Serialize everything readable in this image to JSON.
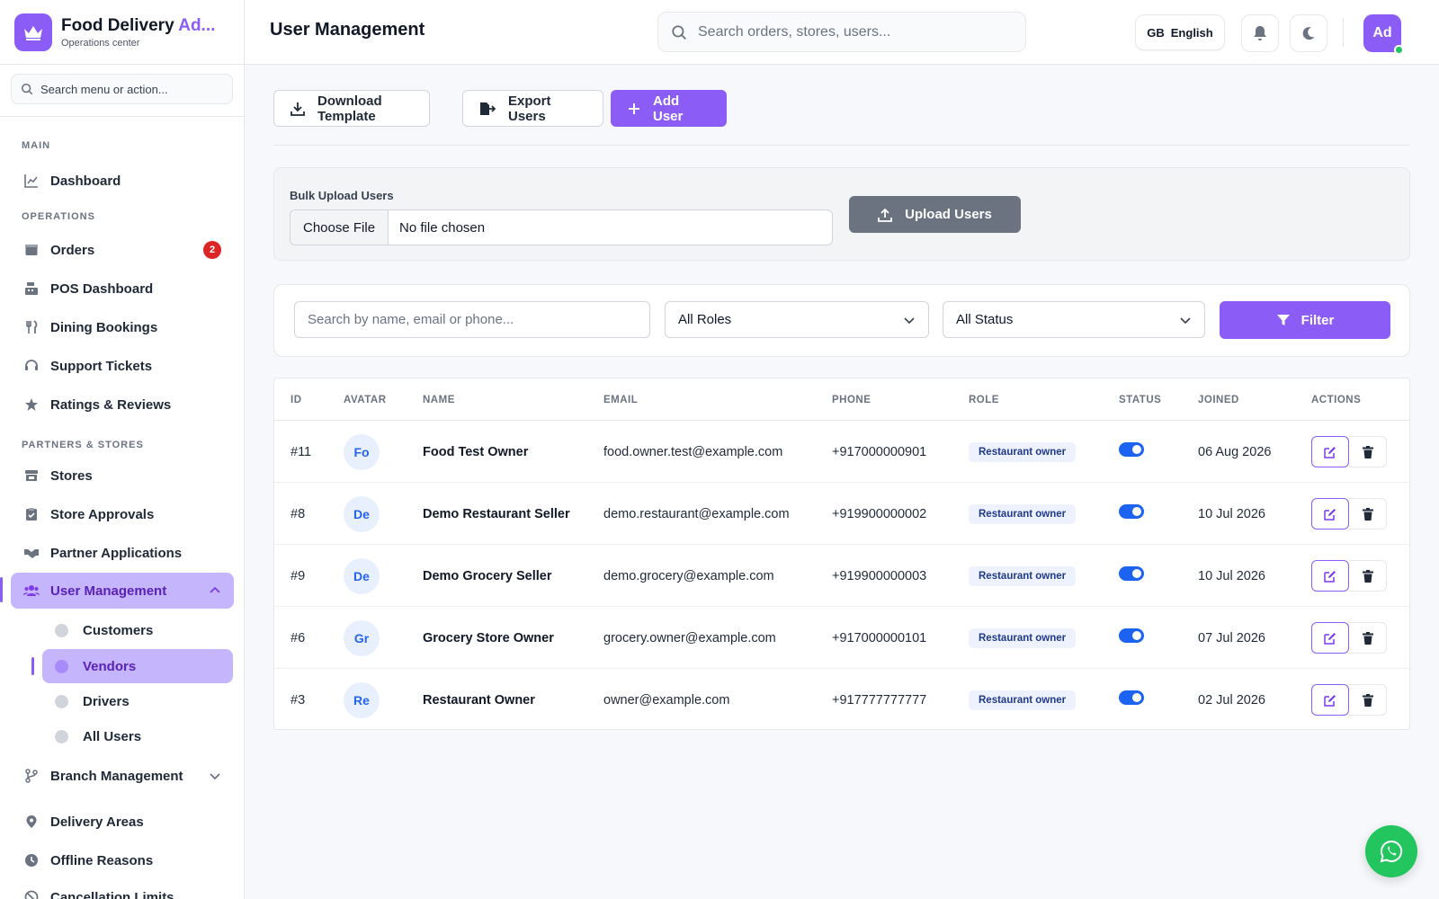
{
  "brand": {
    "title_main": "Food Delivery ",
    "title_accent": "Ad...",
    "subtitle": "Operations center"
  },
  "sidebar": {
    "search_placeholder": "Search menu or action...",
    "sections": {
      "main": "MAIN",
      "operations": "OPERATIONS",
      "partners": "PARTNERS & STORES"
    },
    "items": {
      "dashboard": "Dashboard",
      "orders": "Orders",
      "orders_badge": "2",
      "pos": "POS Dashboard",
      "dining": "Dining Bookings",
      "support": "Support Tickets",
      "ratings": "Ratings & Reviews",
      "stores": "Stores",
      "store_approvals": "Store Approvals",
      "partner_apps": "Partner Applications",
      "user_mgmt": "User Management",
      "customers": "Customers",
      "vendors": "Vendors",
      "drivers": "Drivers",
      "all_users": "All Users",
      "branch_mgmt": "Branch Management",
      "delivery_areas": "Delivery Areas",
      "offline_reasons": "Offline Reasons",
      "cancellation_limits": "Cancellation Limits"
    }
  },
  "topbar": {
    "page_title": "User Management",
    "search_placeholder": "Search orders, stores, users...",
    "lang_code": "GB",
    "lang_label": "English",
    "avatar_initials": "Ad"
  },
  "toolbar": {
    "download_template": "Download Template",
    "export_users": "Export Users",
    "add_user": "Add User"
  },
  "bulk_upload": {
    "label": "Bulk Upload Users",
    "choose_file": "Choose File",
    "no_file": "No file chosen",
    "upload_button": "Upload Users"
  },
  "filters": {
    "search_placeholder": "Search by name, email or phone...",
    "role_selected": "All Roles",
    "status_selected": "All Status",
    "filter_button": "Filter"
  },
  "table": {
    "headers": {
      "id": "ID",
      "avatar": "AVATAR",
      "name": "NAME",
      "email": "EMAIL",
      "phone": "PHONE",
      "role": "ROLE",
      "status": "STATUS",
      "joined": "JOINED",
      "actions": "ACTIONS"
    },
    "rows": [
      {
        "id": "#11",
        "initials": "Fo",
        "name": "Food Test Owner",
        "email": "food.owner.test@example.com",
        "phone": "+917000000901",
        "role": "Restaurant owner",
        "joined": "06 Aug 2026"
      },
      {
        "id": "#8",
        "initials": "De",
        "name": "Demo Restaurant Seller",
        "email": "demo.restaurant@example.com",
        "phone": "+919900000002",
        "role": "Restaurant owner",
        "joined": "10 Jul 2026"
      },
      {
        "id": "#9",
        "initials": "De",
        "name": "Demo Grocery Seller",
        "email": "demo.grocery@example.com",
        "phone": "+919900000003",
        "role": "Restaurant owner",
        "joined": "10 Jul 2026"
      },
      {
        "id": "#6",
        "initials": "Gr",
        "name": "Grocery Store Owner",
        "email": "grocery.owner@example.com",
        "phone": "+917000000101",
        "role": "Restaurant owner",
        "joined": "07 Jul 2026"
      },
      {
        "id": "#3",
        "initials": "Re",
        "name": "Restaurant Owner",
        "email": "owner@example.com",
        "phone": "+917777777777",
        "role": "Restaurant owner",
        "joined": "02 Jul 2026"
      }
    ]
  },
  "colors": {
    "accent": "#8b5cf6",
    "active_bg": "#c4b5fd",
    "badge": "#dc2626",
    "toggle_on": "#1d63f2",
    "whatsapp": "#22c55e"
  }
}
